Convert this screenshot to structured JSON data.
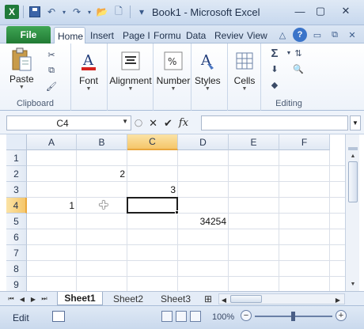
{
  "window": {
    "title": "Book1 - Microsoft Excel",
    "app_icon_letter": "X",
    "controls": {
      "minimize": "—",
      "maximize": "▢",
      "close": "✕"
    }
  },
  "quick_access": {
    "save": "save-icon",
    "undo": "↶",
    "redo": "↷",
    "customize": "▾"
  },
  "ribbon": {
    "file_tab": "File",
    "tabs": [
      "Home",
      "Insert",
      "Page I",
      "Formu",
      "Data",
      "Reviev",
      "View"
    ],
    "active_tab": "Home",
    "right_icons": {
      "collapse": "△",
      "help": "?",
      "min": "▭",
      "restore": "⧉",
      "close": "✕"
    },
    "groups": {
      "clipboard": {
        "label": "Clipboard",
        "paste": "Paste"
      },
      "font": {
        "label": "Font"
      },
      "alignment": {
        "label": "Alignment"
      },
      "number": {
        "label": "Number",
        "symbol": "%"
      },
      "styles": {
        "label": "Styles"
      },
      "cells": {
        "label": "Cells"
      },
      "editing": {
        "label": "Editing",
        "sum": "Σ"
      }
    }
  },
  "formula_bar": {
    "name_box": "C4",
    "cancel": "✕",
    "enter": "✔",
    "fx": "fx",
    "formula": ""
  },
  "grid": {
    "columns": [
      "A",
      "B",
      "C",
      "D",
      "E",
      "F"
    ],
    "rows": [
      "1",
      "2",
      "3",
      "4",
      "5",
      "6",
      "7",
      "8",
      "9"
    ],
    "selected_column": "C",
    "selected_row": "4",
    "active_cell": "C4",
    "cells": {
      "B2": "2",
      "C3": "3",
      "A4": "1",
      "D5": "34254"
    }
  },
  "sheets": {
    "tabs": [
      "Sheet1",
      "Sheet2",
      "Sheet3"
    ],
    "active": "Sheet1"
  },
  "status_bar": {
    "mode": "Edit",
    "zoom": "100%",
    "zoom_minus": "−",
    "zoom_plus": "+"
  }
}
